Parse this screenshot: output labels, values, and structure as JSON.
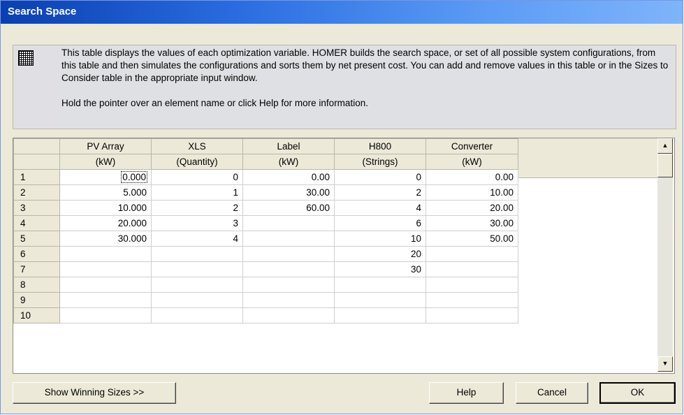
{
  "window": {
    "title": "Search Space"
  },
  "info": {
    "icon": "table-grid-icon",
    "description": "This table displays the values of each optimization variable. HOMER builds the search space, or set of all possible system configurations, from this table and then simulates the configurations and sorts them by net present cost. You can add and remove values in this table or in the Sizes to Consider table in the appropriate input window.",
    "hint": "Hold the pointer over an element name or click Help for more information."
  },
  "table": {
    "columns": [
      {
        "name": "PV Array",
        "unit": "(kW)"
      },
      {
        "name": "XLS",
        "unit": "(Quantity)"
      },
      {
        "name": "Label",
        "unit": "(kW)"
      },
      {
        "name": "H800",
        "unit": "(Strings)"
      },
      {
        "name": "Converter",
        "unit": "(kW)"
      }
    ],
    "row_numbers": [
      "1",
      "2",
      "3",
      "4",
      "5",
      "6",
      "7",
      "8",
      "9",
      "10"
    ],
    "rows": [
      [
        "0.000",
        "0",
        "0.00",
        "0",
        "0.00"
      ],
      [
        "5.000",
        "1",
        "30.00",
        "2",
        "10.00"
      ],
      [
        "10.000",
        "2",
        "60.00",
        "4",
        "20.00"
      ],
      [
        "20.000",
        "3",
        "",
        "6",
        "30.00"
      ],
      [
        "30.000",
        "4",
        "",
        "10",
        "50.00"
      ],
      [
        "",
        "",
        "",
        "20",
        ""
      ],
      [
        "",
        "",
        "",
        "30",
        ""
      ],
      [
        "",
        "",
        "",
        "",
        ""
      ],
      [
        "",
        "",
        "",
        "",
        ""
      ],
      [
        "",
        "",
        "",
        "",
        ""
      ]
    ]
  },
  "scrollbar": {
    "up": "▲",
    "down": "▼"
  },
  "buttons": {
    "show_winning": "Show Winning Sizes >>",
    "help": "Help",
    "cancel": "Cancel",
    "ok": "OK"
  }
}
